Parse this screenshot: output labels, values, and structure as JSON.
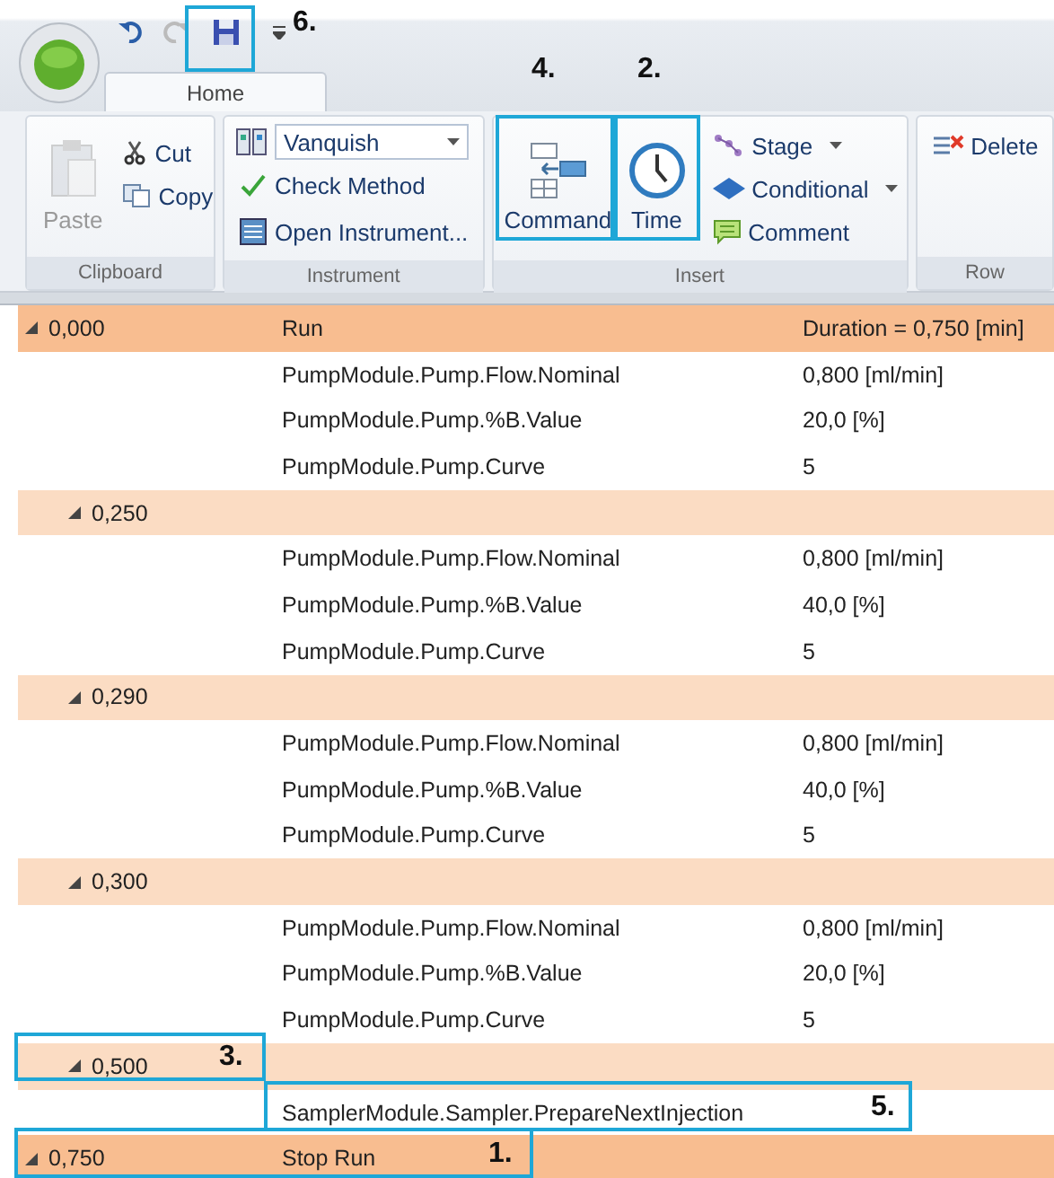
{
  "quick_access": {
    "undo_disabled": false,
    "redo_disabled": true
  },
  "tabs": [
    {
      "label": "Home",
      "selected": true
    }
  ],
  "ribbon": {
    "groups": [
      {
        "kind": "clipboard",
        "label": "Clipboard",
        "paste": {
          "label": "Paste",
          "disabled": true
        },
        "items": [
          {
            "label": "Cut"
          },
          {
            "label": "Copy"
          }
        ]
      },
      {
        "kind": "instrument",
        "label": "Instrument",
        "dropdown": {
          "value": "Vanquish"
        },
        "items": [
          {
            "label": "Check Method"
          },
          {
            "label": "Open Instrument..."
          }
        ]
      },
      {
        "kind": "insert",
        "label": "Insert",
        "large": [
          {
            "label": "Command"
          },
          {
            "label": "Time"
          }
        ],
        "items": [
          {
            "label": "Stage",
            "dropdown": true
          },
          {
            "label": "Conditional",
            "dropdown": true
          },
          {
            "label": "Comment",
            "dropdown": false
          }
        ]
      },
      {
        "kind": "row",
        "label": "Row",
        "items": [
          {
            "label": "Delete"
          }
        ]
      }
    ]
  },
  "method_rows": [
    {
      "kind": "run",
      "time": "0,000",
      "command": "Run",
      "value": "Duration = 0,750 [min]",
      "expanded": true,
      "children": [
        {
          "command": "PumpModule.Pump.Flow.Nominal",
          "value": "0,800 [ml/min]"
        },
        {
          "command": "PumpModule.Pump.%B.Value",
          "value": "20,0 [%]"
        },
        {
          "command": "PumpModule.Pump.Curve",
          "value": "5"
        }
      ]
    },
    {
      "kind": "time",
      "time": "0,250",
      "expanded": true,
      "children": [
        {
          "command": "PumpModule.Pump.Flow.Nominal",
          "value": "0,800 [ml/min]"
        },
        {
          "command": "PumpModule.Pump.%B.Value",
          "value": "40,0 [%]"
        },
        {
          "command": "PumpModule.Pump.Curve",
          "value": "5"
        }
      ]
    },
    {
      "kind": "time",
      "time": "0,290",
      "expanded": true,
      "children": [
        {
          "command": "PumpModule.Pump.Flow.Nominal",
          "value": "0,800 [ml/min]"
        },
        {
          "command": "PumpModule.Pump.%B.Value",
          "value": "40,0 [%]"
        },
        {
          "command": "PumpModule.Pump.Curve",
          "value": "5"
        }
      ]
    },
    {
      "kind": "time",
      "time": "0,300",
      "expanded": true,
      "children": [
        {
          "command": "PumpModule.Pump.Flow.Nominal",
          "value": "0,800 [ml/min]"
        },
        {
          "command": "PumpModule.Pump.%B.Value",
          "value": "20,0 [%]"
        },
        {
          "command": "PumpModule.Pump.Curve",
          "value": "5"
        }
      ]
    },
    {
      "kind": "time",
      "time": "0,500",
      "expanded": true,
      "children": [
        {
          "command": "SamplerModule.Sampler.PrepareNextInjection"
        }
      ]
    },
    {
      "kind": "run",
      "time": "0,750",
      "command": "Stop Run",
      "expanded": true
    }
  ],
  "callouts": [
    {
      "label": "6."
    },
    {
      "label": "4."
    },
    {
      "label": "2."
    },
    {
      "label": "3."
    },
    {
      "label": "5."
    },
    {
      "label": "1."
    }
  ]
}
